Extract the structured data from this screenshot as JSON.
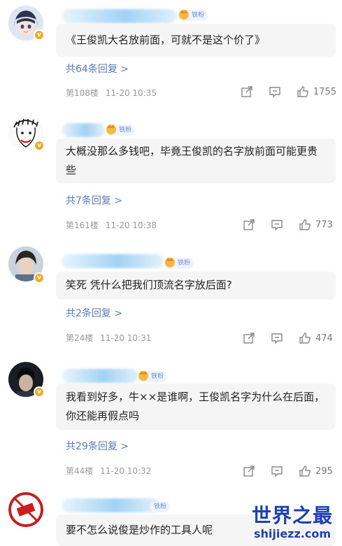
{
  "badge_label": "铁粉",
  "verified_mark": "v",
  "comments": [
    {
      "text": "《王俊凯大名放前面，可就不是这个价了》",
      "replies": "共64条回复 >",
      "floor": "第108楼",
      "time": "11-20 10:35",
      "likes": "1755",
      "avatar": "anime-avatar"
    },
    {
      "text": "大概没那么多钱吧，毕竟王俊凯的名字放前面可能更贵些",
      "replies": "共7条回复 >",
      "floor": "第161楼",
      "time": "11-20 10:38",
      "likes": "773",
      "avatar": "sketch-face-avatar"
    },
    {
      "text": "笑死 凭什么把我们顶流名字放后面?",
      "replies": "共2条回复 >",
      "floor": "第24楼",
      "time": "11-20 10:31",
      "likes": "474",
      "avatar": "portrait-avatar"
    },
    {
      "text": "我看到好多，牛××是谁啊，王俊凯名字为什么在后面，你还能再假点吗",
      "replies": "共29条回复 >",
      "floor": "第44楼",
      "time": "11-20 10:32",
      "likes": "295",
      "avatar": "dark-portrait-avatar"
    },
    {
      "text": "要不怎么说俊是炒作的工具人呢",
      "avatar": "do-not-touch-avatar",
      "avatar_text": "Don't Touch Me"
    }
  ],
  "watermark": {
    "title": "世界之最",
    "url": "shijiezz.com"
  },
  "colors": {
    "link": "#5b7bb8",
    "bubble": "#f5f5f5",
    "badge_bg": "#eef4ff",
    "verified": "#f0a92c",
    "watermark": "#1e3fb0"
  }
}
